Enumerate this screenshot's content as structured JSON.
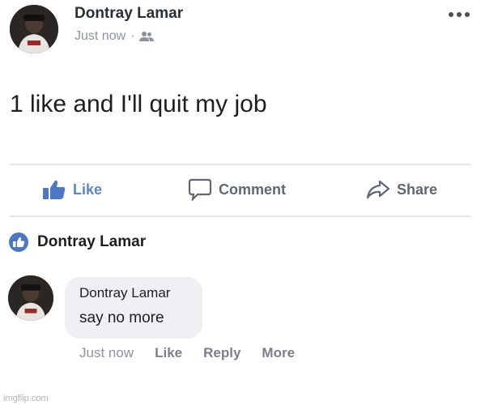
{
  "post": {
    "author": "Dontray Lamar",
    "timestamp": "Just now",
    "separator": "·",
    "audience_icon": "friends-icon",
    "text": "1 like and I'll quit my job"
  },
  "actions": {
    "like": "Like",
    "comment": "Comment",
    "share": "Share"
  },
  "page_reply": {
    "name": "Dontray Lamar",
    "icon": "like-badge-icon"
  },
  "comment": {
    "author": "Dontray Lamar",
    "text": "say no more",
    "timestamp": "Just now",
    "like": "Like",
    "reply": "Reply",
    "more": "More"
  },
  "watermark": "imgflip.com",
  "colors": {
    "like_blue": "#5a86cf",
    "action_gray": "#606770",
    "bubble_bg": "#eef0f3",
    "divider": "#e3e5e8"
  }
}
